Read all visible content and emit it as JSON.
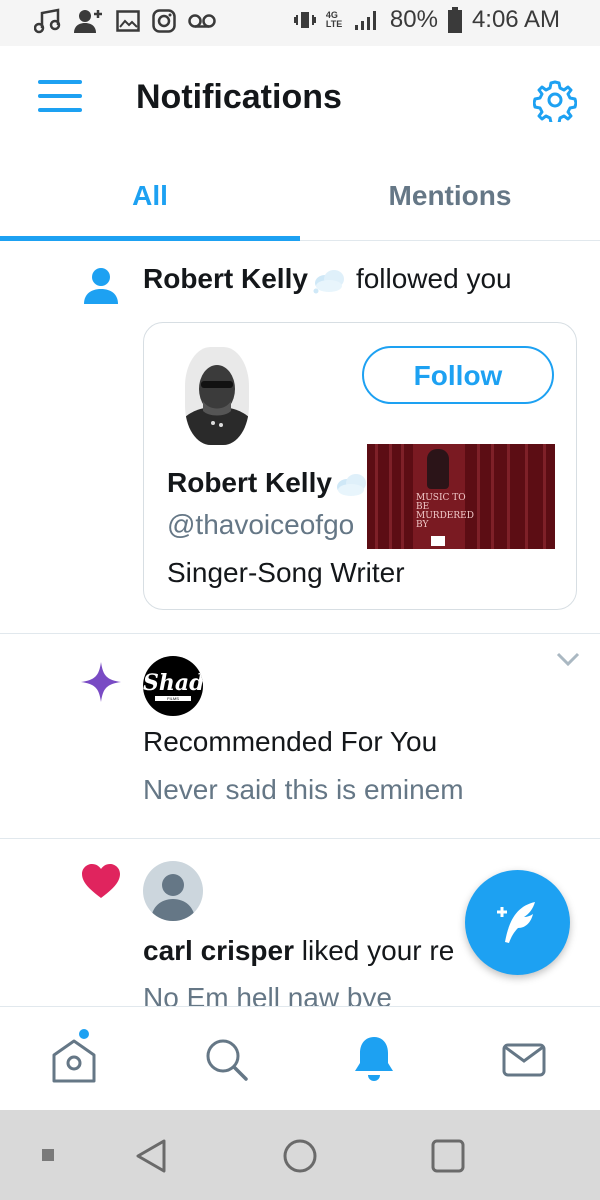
{
  "status_bar": {
    "network": "4G LTE",
    "battery": "80%",
    "time": "4:06 AM"
  },
  "header": {
    "title": "Notifications"
  },
  "tabs": [
    {
      "label": "All",
      "active": true
    },
    {
      "label": "Mentions",
      "active": false
    }
  ],
  "notifications": [
    {
      "type": "follow",
      "icon": "person-icon",
      "actor": "Robert Kelly",
      "action": "followed you",
      "card": {
        "name": "Robert Kelly",
        "handle": "@thavoiceofgo",
        "bio": "Singer-Song Writer",
        "follow_label": "Follow",
        "album_text": "MUSIC TO BE MURDERED BY"
      }
    },
    {
      "type": "recommendation",
      "icon": "sparkle-icon",
      "avatar_logo": "Shady",
      "avatar_sub": "FILMS",
      "title": "Recommended For You",
      "subtitle": "Never said this is eminem"
    },
    {
      "type": "like",
      "icon": "heart-icon",
      "actor": "carl crisper",
      "action": "liked your re",
      "subtitle": "No Em hell naw bye"
    }
  ],
  "colors": {
    "accent": "#1da1f2",
    "secondary_text": "#657786",
    "like": "#e0245e",
    "sparkle": "#794bc4"
  },
  "bottom_nav": [
    "home-icon",
    "search-icon",
    "notifications-icon",
    "messages-icon"
  ],
  "system_nav": [
    "recents-indicator",
    "back-icon",
    "home-circle-icon",
    "overview-icon"
  ]
}
